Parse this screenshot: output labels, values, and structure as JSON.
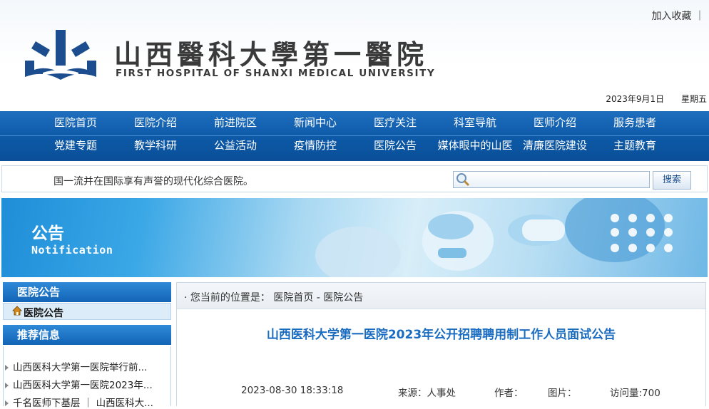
{
  "header": {
    "favorite_link": "加入收藏 ｜",
    "title_cn": "山西醫科大學第一醫院",
    "title_en": "FIRST HOSPITAL OF SHANXI MEDICAL UNIVERSITY",
    "date": "2023年9月1日",
    "weekday": "星期五",
    "logo_color": "#1c4e8f"
  },
  "nav": {
    "row1": [
      "医院首页",
      "医院介绍",
      "前进院区",
      "新闻中心",
      "医疗关注",
      "科室导航",
      "医师介绍",
      "服务患者"
    ],
    "row2": [
      "党建专题",
      "教学科研",
      "公益活动",
      "疫情防控",
      "医院公告",
      "媒体眼中的山医",
      "清廉医院建设",
      "主题教育"
    ]
  },
  "search": {
    "marquee": "国一流并在国际享有声誉的现代化综合医院。",
    "placeholder": "",
    "button_label": "搜索"
  },
  "banner": {
    "title_cn": "公告",
    "title_en": "Notification"
  },
  "sidebar": {
    "section1_title": "医院公告",
    "section1_item": "医院公告",
    "section2_title": "推荐信息",
    "items": [
      "山西医科大学第一医院举行前...",
      "山西医科大学第一医院2023年...",
      "千名医师下基层 ｜ 山西医科大..."
    ]
  },
  "main": {
    "crumb_prefix": "· 您当前的位置是：",
    "crumb_home": "医院首页",
    "crumb_sep": " - ",
    "crumb_current": "医院公告",
    "article_title": "山西医科大学第一医院2023年公开招聘聘用制工作人员面试公告",
    "meta": {
      "datetime": "2023-08-30 18:33:18",
      "source": "来源：人事处",
      "author": "作者：",
      "images": "图片：",
      "visits": "访问量:700"
    }
  },
  "colors": {
    "nav_blue": "#0d5aa8",
    "title_blue": "#1a6cc0",
    "sidebar_head": "#1264b6"
  }
}
